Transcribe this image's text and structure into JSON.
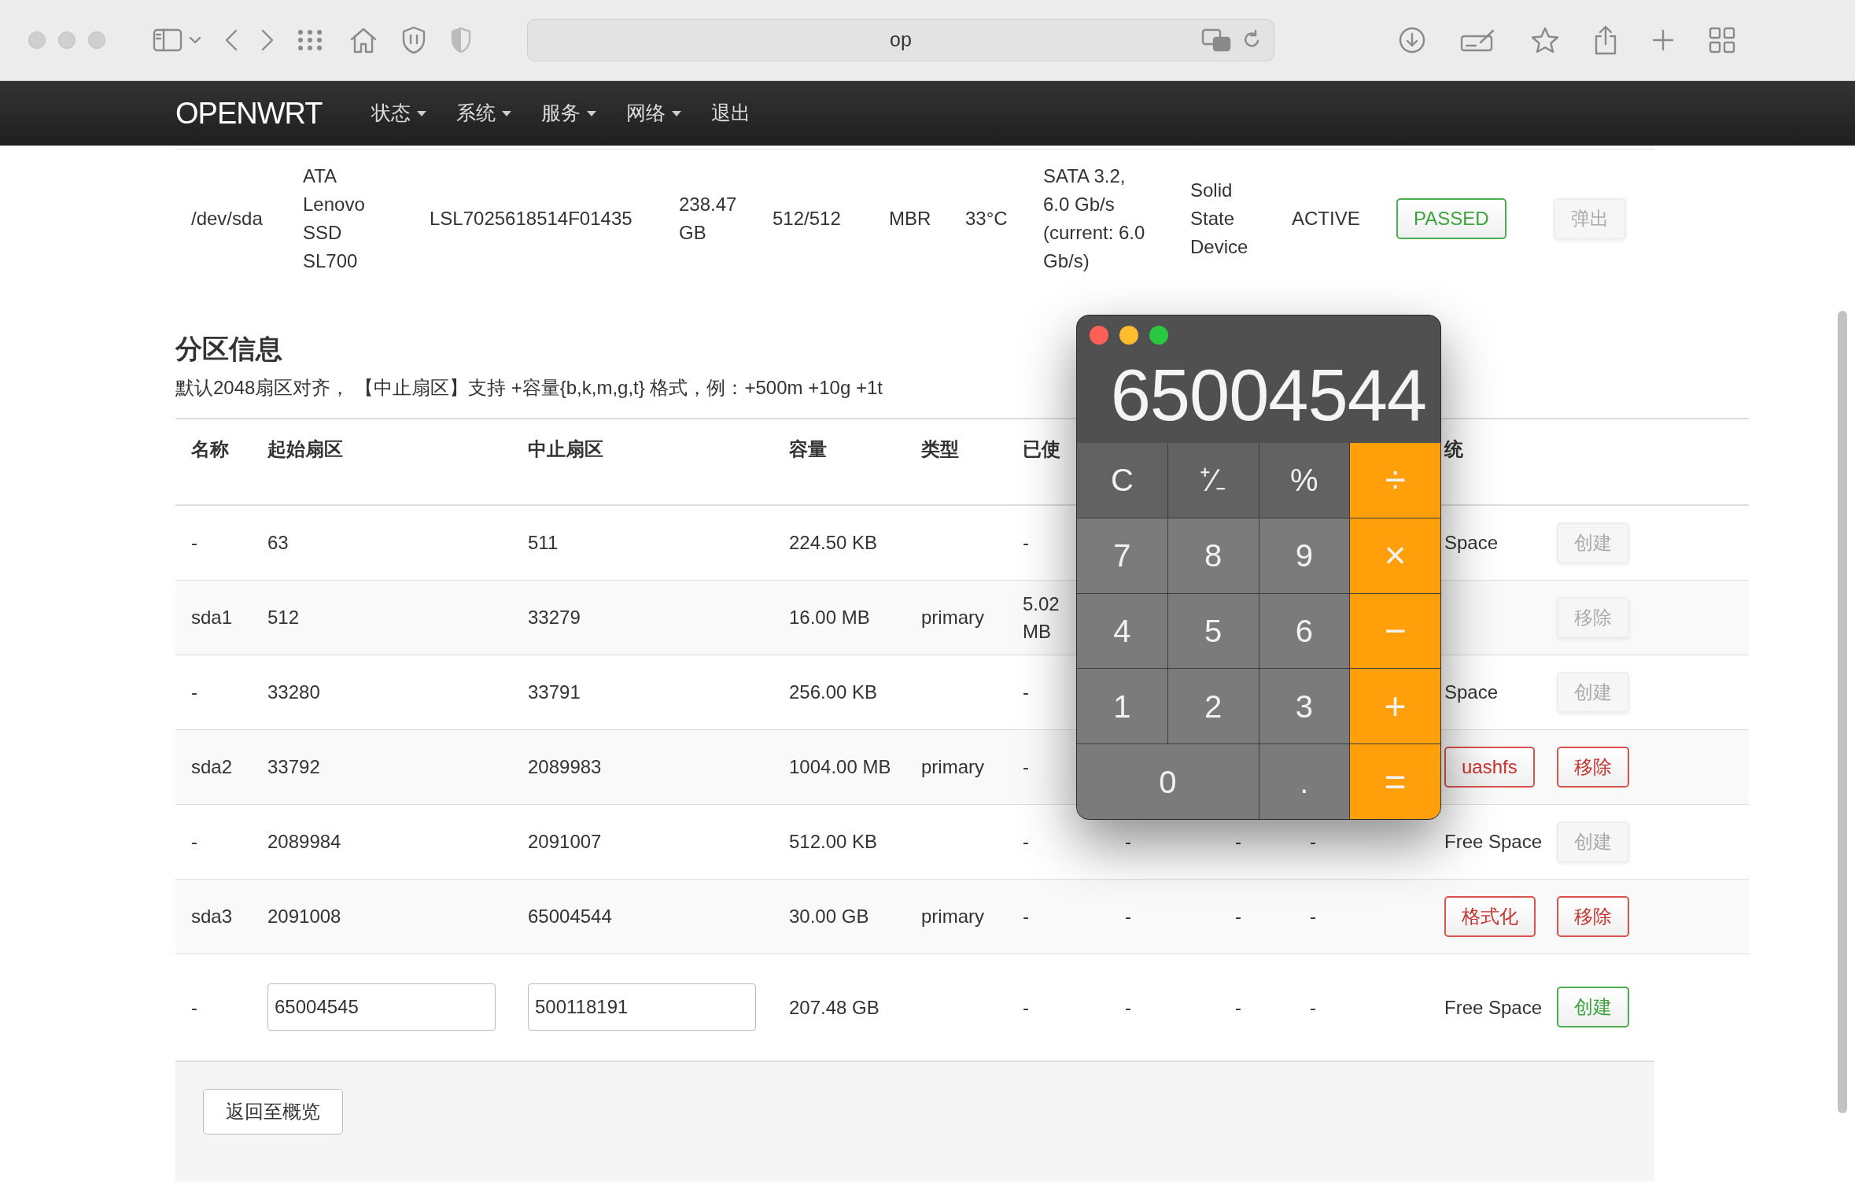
{
  "browser": {
    "address": "op"
  },
  "navbar": {
    "brand": "OPENWRT",
    "items": [
      {
        "label": "状态",
        "dropdown": true
      },
      {
        "label": "系统",
        "dropdown": true
      },
      {
        "label": "服务",
        "dropdown": true
      },
      {
        "label": "网络",
        "dropdown": true
      },
      {
        "label": "退出",
        "dropdown": false
      }
    ]
  },
  "disk": {
    "cells": [
      "/dev/sda",
      "ATA Lenovo SSD SL700",
      "LSL7025618514F01435",
      "238.47 GB",
      "512/512",
      "MBR",
      "33°C",
      "SATA 3.2, 6.0 Gb/s (current: 6.0 Gb/s)",
      "Solid State Device",
      "ACTIVE"
    ],
    "health": {
      "label": "PASSED",
      "kind": "success"
    },
    "action": {
      "label": "弹出",
      "kind": "muted"
    }
  },
  "partitions": {
    "title": "分区信息",
    "note": "默认2048扇区对齐， 【中止扇区】支持 +容量{b,k,m,g,t} 格式，例：+500m +10g +1t",
    "columns": [
      "名称",
      "起始扇区",
      "中止扇区",
      "容量",
      "类型",
      "已使"
    ],
    "filesystem_header": "统",
    "rows": [
      {
        "name": "-",
        "start": "63",
        "end": "511",
        "size": "224.50 KB",
        "used": "-",
        "filesystem": "Space",
        "action": {
          "label": "创建",
          "kind": "muted"
        }
      },
      {
        "name": "sda1",
        "start": "512",
        "end": "33279",
        "size": "16.00 MB",
        "type": "primary",
        "used": "5.02 MB",
        "action": {
          "label": "移除",
          "kind": "muted"
        }
      },
      {
        "name": "-",
        "start": "33280",
        "end": "33791",
        "size": "256.00 KB",
        "used": "-",
        "filesystem": "Space",
        "action": {
          "label": "创建",
          "kind": "muted"
        }
      },
      {
        "name": "sda2",
        "start": "33792",
        "end": "2089983",
        "size": "1004.00 MB",
        "type": "primary",
        "used": "-",
        "filesystem": {
          "label": "uashfs",
          "kind": "danger"
        },
        "action": {
          "label": "移除",
          "kind": "danger"
        }
      },
      {
        "name": "-",
        "start": "2089984",
        "end": "2091007",
        "size": "512.00 KB",
        "used": "-",
        "column_7": "-",
        "column_8": "-",
        "column_9": "-",
        "filesystem": "Free Space",
        "action": {
          "label": "创建",
          "kind": "muted"
        }
      },
      {
        "name": "sda3",
        "start": "2091008",
        "end": "65004544",
        "size": "30.00 GB",
        "type": "primary",
        "used": "-",
        "column_7": "-",
        "column_8": "-",
        "column_9": "-",
        "filesystem": {
          "label": "格式化",
          "kind": "danger"
        },
        "action": {
          "label": "移除",
          "kind": "danger"
        }
      },
      {
        "name": "-",
        "start": {
          "kind": "input",
          "value": "65004545"
        },
        "end": {
          "kind": "input",
          "value": "500118191"
        },
        "size": "207.48 GB",
        "used": "-",
        "column_7": "-",
        "column_8": "-",
        "column_9": "-",
        "filesystem": "Free Space",
        "action": {
          "label": "创建",
          "kind": "success"
        }
      }
    ],
    "back_button": "返回至概览"
  },
  "calculator": {
    "display": "65004544",
    "keys": [
      {
        "label": "C",
        "kind": "function"
      },
      {
        "label": "⁺∕₋",
        "kind": "function"
      },
      {
        "label": "%",
        "kind": "function"
      },
      {
        "label": "÷",
        "kind": "operator"
      },
      {
        "label": "7",
        "kind": "digit"
      },
      {
        "label": "8",
        "kind": "digit"
      },
      {
        "label": "9",
        "kind": "digit"
      },
      {
        "label": "×",
        "kind": "operator"
      },
      {
        "label": "4",
        "kind": "digit"
      },
      {
        "label": "5",
        "kind": "digit"
      },
      {
        "label": "6",
        "kind": "digit"
      },
      {
        "label": "−",
        "kind": "operator"
      },
      {
        "label": "1",
        "kind": "digit"
      },
      {
        "label": "2",
        "kind": "digit"
      },
      {
        "label": "3",
        "kind": "digit"
      },
      {
        "label": "+",
        "kind": "operator"
      },
      {
        "label": "0",
        "kind": "wide"
      },
      {
        "label": ".",
        "kind": "digit"
      },
      {
        "label": "=",
        "kind": "operator"
      }
    ]
  }
}
